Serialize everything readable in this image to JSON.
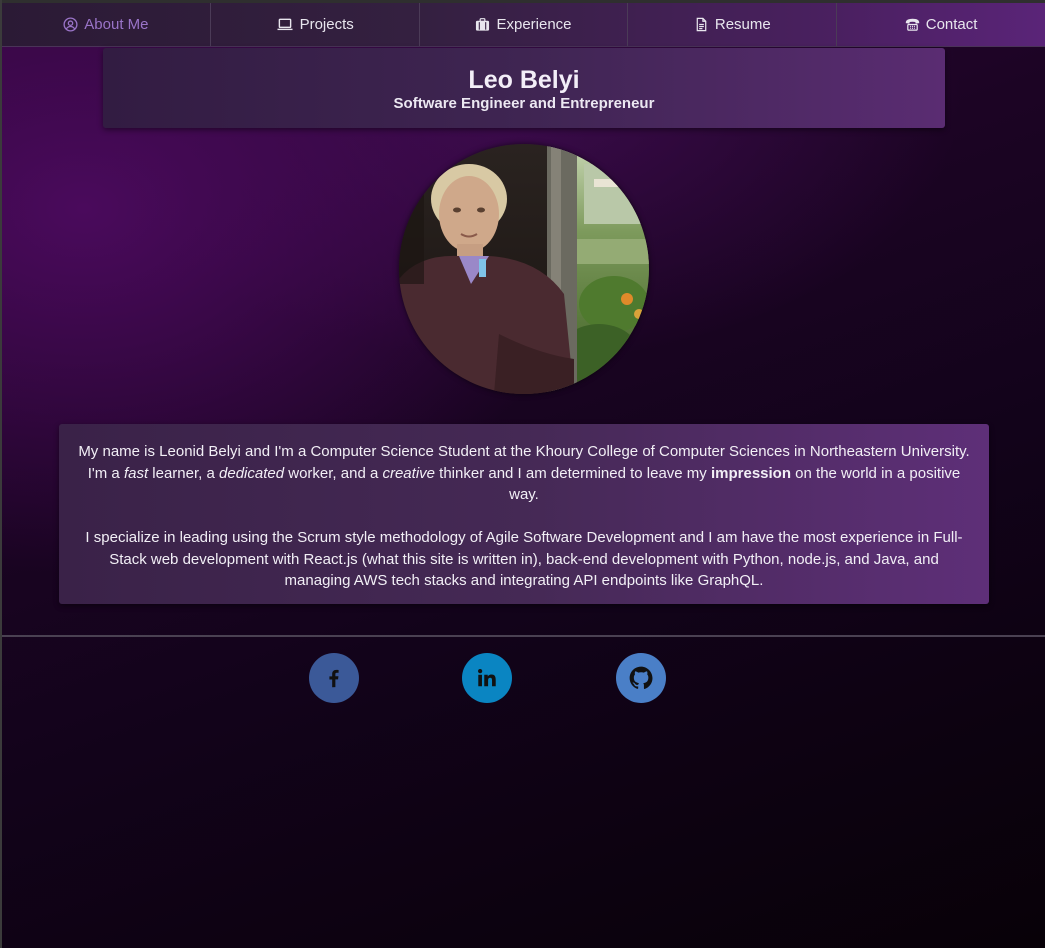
{
  "nav": {
    "items": [
      {
        "label": "About Me",
        "icon": "user-circle-icon",
        "active": true
      },
      {
        "label": "Projects",
        "icon": "laptop-icon",
        "active": false
      },
      {
        "label": "Experience",
        "icon": "briefcase-icon",
        "active": false
      },
      {
        "label": "Resume",
        "icon": "document-icon",
        "active": false
      },
      {
        "label": "Contact",
        "icon": "phone-icon",
        "active": false
      }
    ]
  },
  "header": {
    "name": "Leo Belyi",
    "subtitle": "Software Engineer and Entrepreneur"
  },
  "bio": {
    "p1": {
      "t1": "My name is Leonid Belyi and I'm a Computer Science Student at the Khoury College of Computer Sciences in Northeastern University. I'm a ",
      "fast": "fast",
      "t2": " learner, a ",
      "dedicated": "dedicated",
      "t3": " worker, and a ",
      "creative": "creative",
      "t4": " thinker and I am determined to leave my ",
      "impression": "impression",
      "t5": " on the world in a positive way."
    },
    "p2": "I specialize in leading using the Scrum style methodology of Agile Software Development and I am have the most experience in Full-Stack web development with React.js (what this site is written in), back-end development with Python, node.js, and Java, and managing AWS tech stacks and integrating API endpoints like GraphQL."
  },
  "social": [
    {
      "name": "facebook",
      "icon": "facebook-icon",
      "color": "#3b5998"
    },
    {
      "name": "linkedin",
      "icon": "linkedin-icon",
      "color": "#0a85c2"
    },
    {
      "name": "github",
      "icon": "github-icon",
      "color": "#4a7fc7"
    }
  ],
  "colors": {
    "active_nav": "#9a74c8",
    "card_purple": "#452955",
    "background_dark": "#12031a"
  }
}
